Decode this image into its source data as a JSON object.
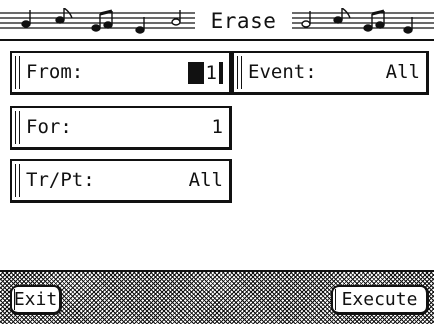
{
  "title": "Erase",
  "parameters": [
    {
      "label": "From:",
      "value": "1",
      "selected": true
    },
    {
      "label": "For:",
      "value": "1"
    },
    {
      "label": "Tr/Pt:",
      "value": "All"
    },
    {
      "label": "Event:",
      "value": "All"
    }
  ],
  "buttons": {
    "exit": "Exit",
    "execute": "Execute"
  },
  "icons": {
    "title_decoration": "music-staff-icon"
  }
}
